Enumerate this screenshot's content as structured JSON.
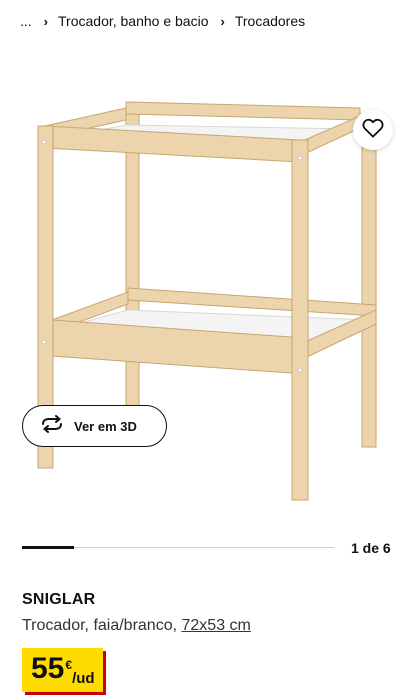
{
  "breadcrumb": {
    "ellipsis": "...",
    "items": [
      "Trocador, banho e bacio",
      "Trocadores"
    ]
  },
  "gallery": {
    "view_3d_label": "Ver em 3D",
    "counter": "1 de 6",
    "current_index": 1,
    "total_images": 6,
    "progress_fraction": 0.1667
  },
  "product": {
    "name": "SNIGLAR",
    "description": "Trocador, faia/branco, ",
    "dimensions": "72x53 cm",
    "price": {
      "amount": "55",
      "currency": "€",
      "unit": "/ud"
    }
  },
  "icons": {
    "favorite": "heart-icon",
    "view_3d": "rotate-icon",
    "breadcrumb_separator": "chevron-right-icon"
  },
  "colors": {
    "price_badge": "#ffdb00",
    "price_shadow": "#cc0008",
    "wood": "#ecd5ac",
    "text": "#111111"
  }
}
